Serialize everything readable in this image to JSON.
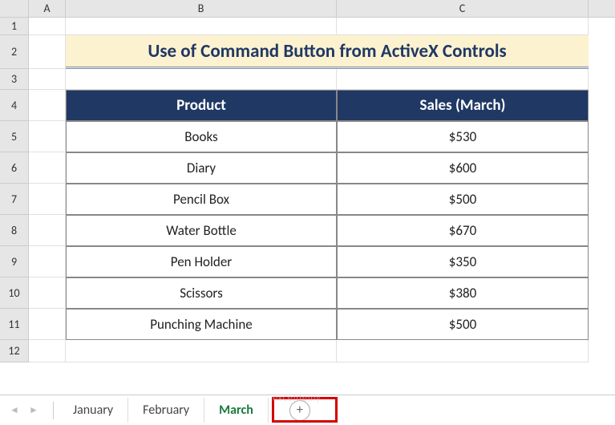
{
  "columns": {
    "A": "A",
    "B": "B",
    "C": "C"
  },
  "rows": [
    "1",
    "2",
    "3",
    "4",
    "5",
    "6",
    "7",
    "8",
    "9",
    "10",
    "11",
    "12"
  ],
  "title": "Use of Command Button from ActiveX Controls",
  "table": {
    "headers": {
      "product": "Product",
      "sales": "Sales (March)"
    },
    "data": [
      {
        "product": "Books",
        "sales": "$530"
      },
      {
        "product": "Diary",
        "sales": "$600"
      },
      {
        "product": "Pencil Box",
        "sales": "$500"
      },
      {
        "product": "Water Bottle",
        "sales": "$670"
      },
      {
        "product": "Pen Holder",
        "sales": "$350"
      },
      {
        "product": "Scissors",
        "sales": "$380"
      },
      {
        "product": "Punching Machine",
        "sales": "$500"
      }
    ]
  },
  "tabs": {
    "items": [
      "January",
      "February",
      "March"
    ],
    "active": "March"
  },
  "addSheet": "+",
  "watermark": "exceldemy",
  "chart_data": {
    "type": "table",
    "title": "Use of Command Button from ActiveX Controls",
    "columns": [
      "Product",
      "Sales (March)"
    ],
    "rows": [
      [
        "Books",
        530
      ],
      [
        "Diary",
        600
      ],
      [
        "Pencil Box",
        500
      ],
      [
        "Water Bottle",
        670
      ],
      [
        "Pen Holder",
        350
      ],
      [
        "Scissors",
        380
      ],
      [
        "Punching Machine",
        500
      ]
    ]
  }
}
